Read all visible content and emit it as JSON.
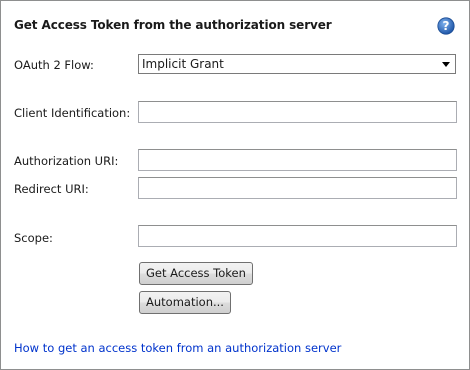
{
  "panel": {
    "title": "Get Access Token from the authorization server"
  },
  "form": {
    "flow_label": "OAuth 2 Flow:",
    "flow_value": "Implicit Grant",
    "client_id_label": "Client Identification:",
    "client_id_value": "",
    "auth_uri_label": "Authorization URI:",
    "auth_uri_value": "",
    "redirect_uri_label": "Redirect URI:",
    "redirect_uri_value": "",
    "scope_label": "Scope:",
    "scope_value": ""
  },
  "buttons": {
    "get_token": "Get Access Token",
    "automation": "Automation..."
  },
  "help_link": "How to get an access token from an authorization server",
  "icons": {
    "help": "help-icon",
    "dropdown": "chevron-down-icon"
  },
  "colors": {
    "link": "#0033cc",
    "help_icon": "#2f6bbd"
  }
}
